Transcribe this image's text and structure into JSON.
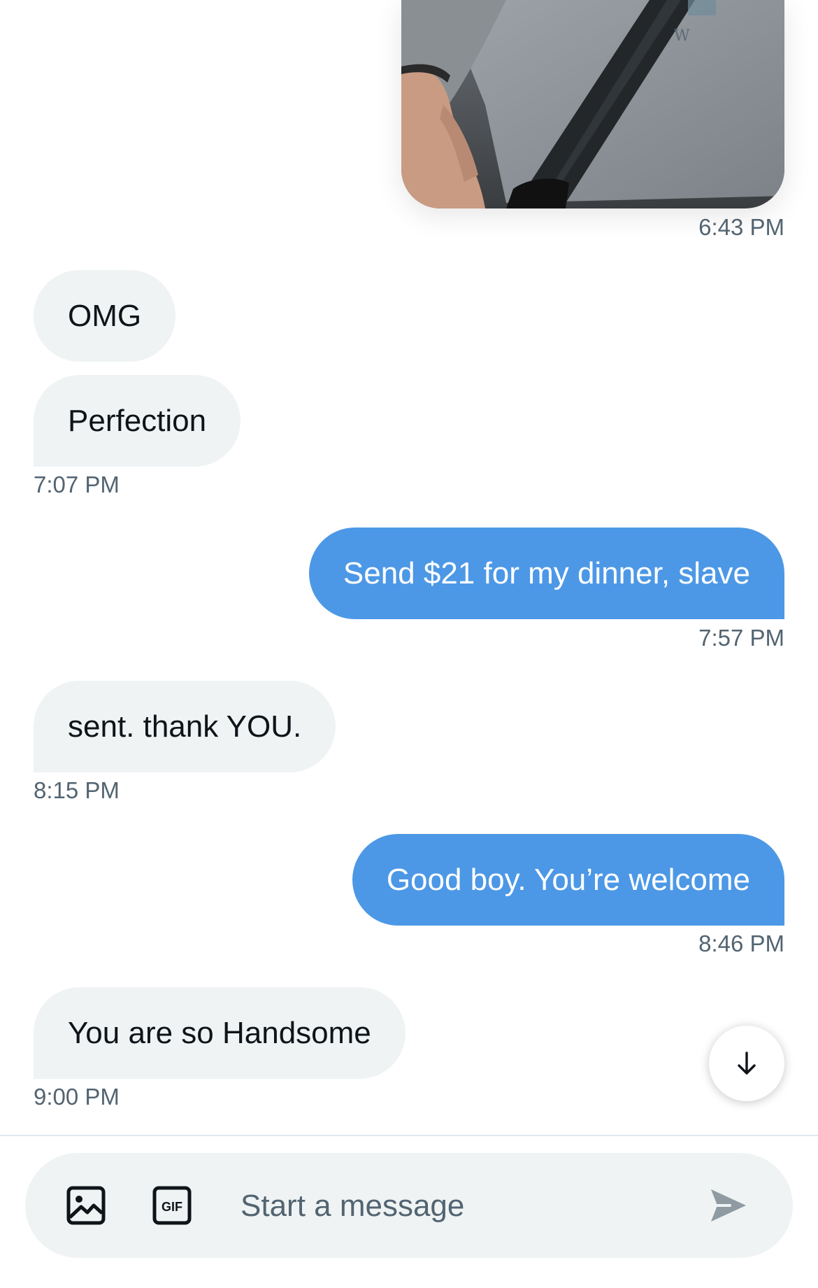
{
  "conversation": {
    "photo_time": "6:43 PM",
    "messages": [
      {
        "id": "m1",
        "from": "them",
        "text": "OMG"
      },
      {
        "id": "m2",
        "from": "them",
        "text": "Perfection",
        "time": "7:07 PM"
      },
      {
        "id": "m3",
        "from": "me",
        "text": "Send $21 for my dinner, slave",
        "time": "7:57 PM"
      },
      {
        "id": "m4",
        "from": "them",
        "text": "sent. thank YOU.",
        "time": "8:15 PM"
      },
      {
        "id": "m5",
        "from": "me",
        "text": "Good boy. You’re welcome",
        "time": "8:46 PM"
      },
      {
        "id": "m6",
        "from": "them",
        "text": "You are so Handsome",
        "time": "9:00 PM"
      }
    ]
  },
  "composer": {
    "placeholder": "Start a message",
    "gif_label": "GIF",
    "image_icon": "image-icon",
    "send_icon": "send-icon"
  },
  "scroll_button": {
    "icon": "arrow-down-icon"
  },
  "colors": {
    "outgoing_bubble": "#4c98e6",
    "incoming_bubble": "#eff3f4",
    "secondary_text": "#536471"
  }
}
